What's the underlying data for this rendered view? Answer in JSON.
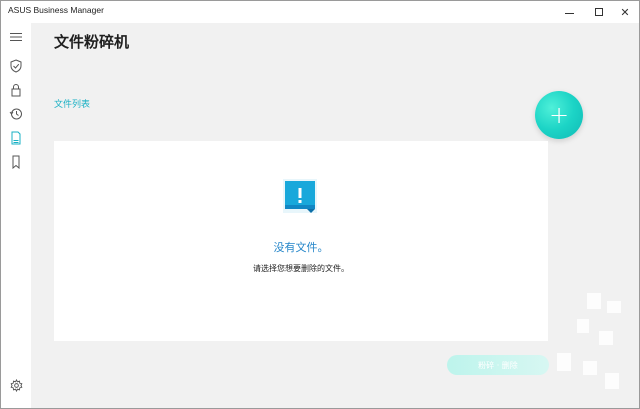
{
  "window": {
    "app_title": "ASUS Business Manager",
    "minimize_icon": "minimize-icon",
    "maximize_icon": "maximize-icon",
    "close_glyph": "✕"
  },
  "rail": {
    "items": [
      {
        "name": "menu-icon"
      },
      {
        "name": "shield-check-icon"
      },
      {
        "name": "lock-icon"
      },
      {
        "name": "history-icon"
      },
      {
        "name": "document-icon",
        "active": true
      },
      {
        "name": "bookmark-icon"
      }
    ],
    "settings_icon": "gear-icon"
  },
  "page": {
    "title": "文件粉碎机",
    "section_label": "文件列表",
    "add_glyph": "+",
    "empty": {
      "icon": "document-alert-icon",
      "title": "没有文件。",
      "subtitle": "请选择您想要删除的文件。"
    },
    "delete_button_label": "粉碎 · 删除"
  },
  "colors": {
    "accent": "#18b0c4",
    "add_button": "#1cd4c6",
    "empty_title": "#2586c9",
    "background": "#f1f1f1"
  }
}
